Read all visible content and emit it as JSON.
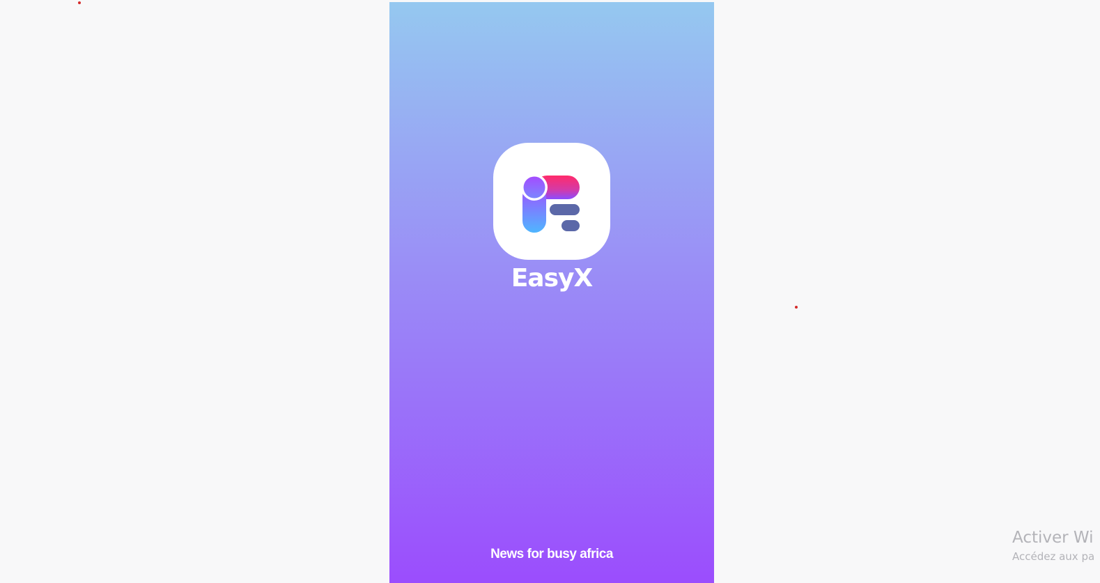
{
  "splash": {
    "app_name": "EasyX",
    "tagline": "News for busy africa",
    "logo_icon": "easyx-logo-icon",
    "colors": {
      "gradient_top": "#95c8f0",
      "gradient_mid": "#9a8ff6",
      "gradient_bottom": "#9b4dfd",
      "logo_bar_gradient": [
        "#ff2b6b",
        "#8b4cff"
      ],
      "logo_pill_gradient": [
        "#a44cff",
        "#4fb6ff"
      ],
      "logo_lines": "#5b68a8"
    }
  },
  "os_watermark": {
    "title": "Activer Wi",
    "subtitle": "Accédez aux pa"
  }
}
